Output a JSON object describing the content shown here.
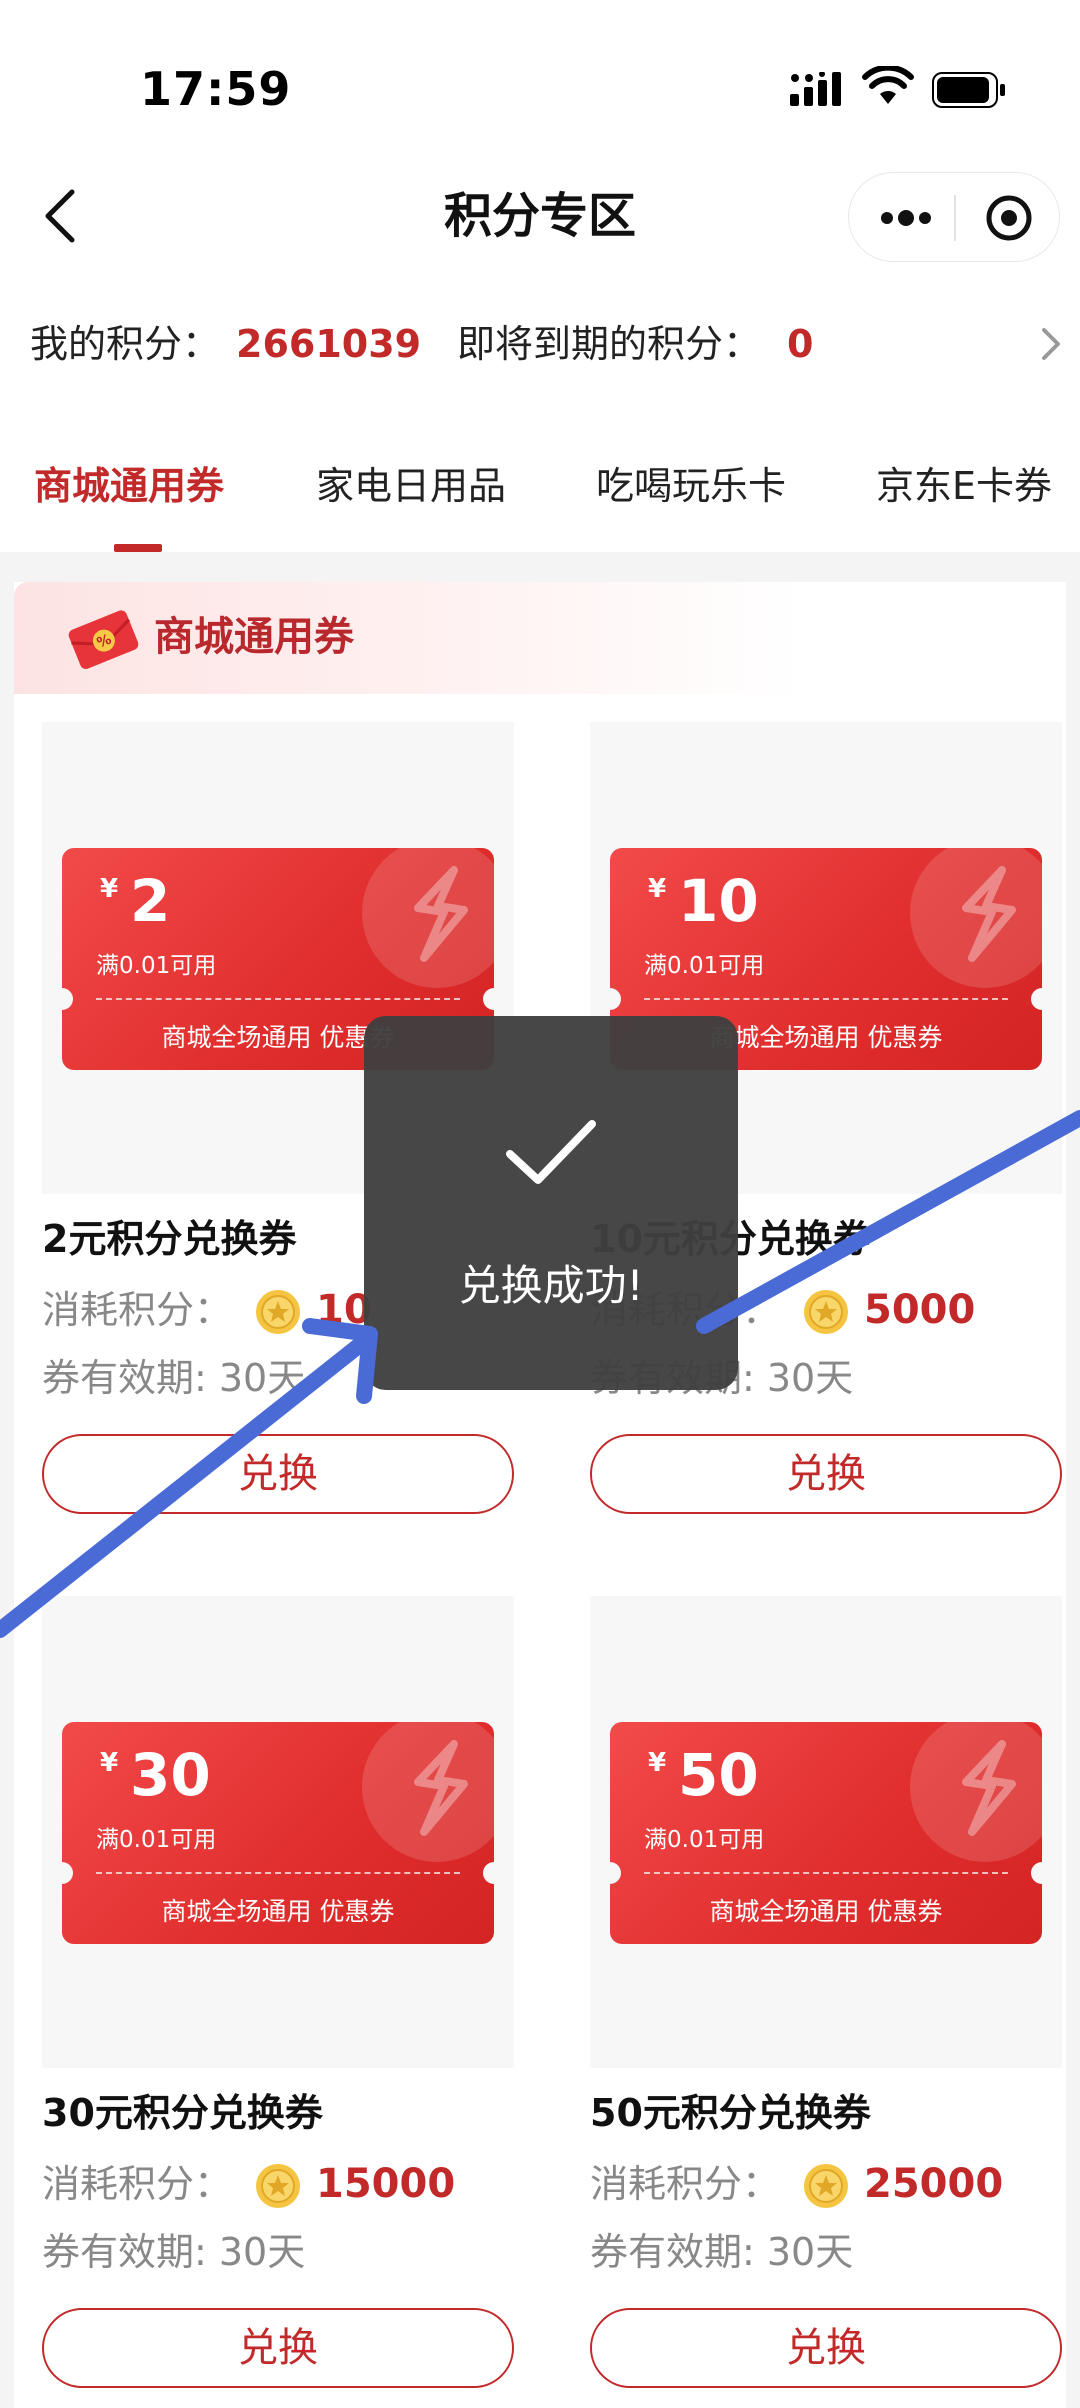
{
  "status_bar": {
    "time": "17:59"
  },
  "nav": {
    "title": "积分专区"
  },
  "points": {
    "my_label": "我的积分：",
    "my_value": "2661039",
    "expire_label": "即将到期的积分：",
    "expire_value": "0"
  },
  "tabs": [
    {
      "label": "商城通用券",
      "active": true
    },
    {
      "label": "家电日用品",
      "active": false
    },
    {
      "label": "吃喝玩乐卡",
      "active": false
    },
    {
      "label": "京东E卡券",
      "active": false
    }
  ],
  "section": {
    "title": "商城通用券"
  },
  "coupons": [
    {
      "yen": "¥",
      "amount": "2",
      "condition": "满0.01可用",
      "desc": "商城全场通用 优惠券",
      "name": "2元积分兑换券",
      "cost_label": "消耗积分：",
      "cost": "10",
      "validity": "券有效期: 30天",
      "button": "兑换"
    },
    {
      "yen": "¥",
      "amount": "10",
      "condition": "满0.01可用",
      "desc": "商城全场通用 优惠券",
      "name": "10元积分兑换券",
      "cost_label": "消耗积分：",
      "cost": "5000",
      "validity": "券有效期: 30天",
      "button": "兑换"
    },
    {
      "yen": "¥",
      "amount": "30",
      "condition": "满0.01可用",
      "desc": "商城全场通用 优惠券",
      "name": "30元积分兑换券",
      "cost_label": "消耗积分：",
      "cost": "15000",
      "validity": "券有效期: 30天",
      "button": "兑换"
    },
    {
      "yen": "¥",
      "amount": "50",
      "condition": "满0.01可用",
      "desc": "商城全场通用 优惠券",
      "name": "50元积分兑换券",
      "cost_label": "消耗积分：",
      "cost": "25000",
      "validity": "券有效期: 30天",
      "button": "兑换"
    }
  ],
  "toast": {
    "text": "兑换成功!"
  },
  "colors": {
    "accent": "#c22a2a",
    "coupon_red": "#e02d2d",
    "toast_bg": "#404040",
    "annotation_arrow": "#4a6bd6"
  },
  "icons": [
    "back-icon",
    "more-icon",
    "close-circle-icon",
    "chevron-right-icon",
    "coupon-icon",
    "coin-icon",
    "check-icon"
  ]
}
